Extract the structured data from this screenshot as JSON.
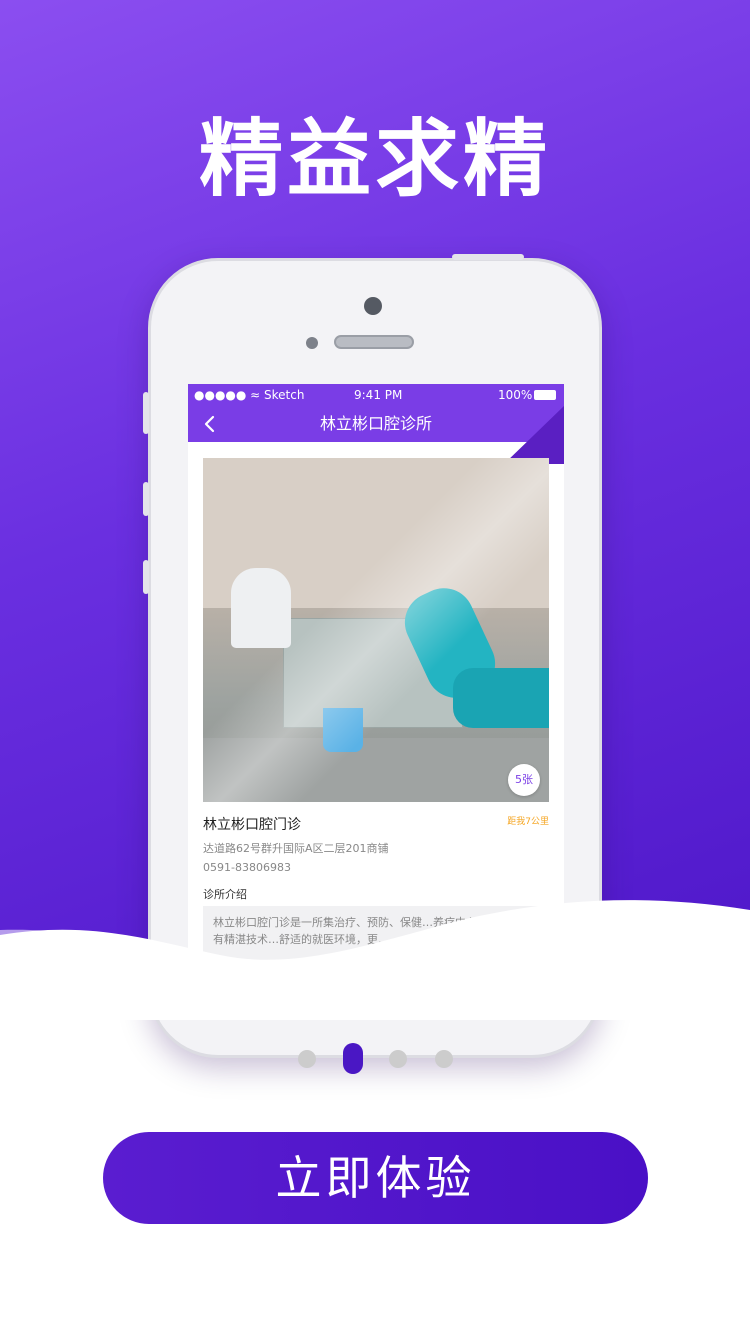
{
  "hero": {
    "title": "精益求精"
  },
  "phone_screen": {
    "status": {
      "carrier": "●●●●● ≈ Sketch",
      "time": "9:41 PM",
      "battery": "100%"
    },
    "navbar": {
      "title": "林立彬口腔诊所",
      "back_icon": "chevron-left-icon"
    },
    "photo": {
      "count_badge": "5张"
    },
    "clinic": {
      "name": "林立彬口腔门诊",
      "distance": "距我7公里",
      "address": "达道路62号群升国际A区二层201商铺",
      "phone": "0591-83806983",
      "intro_title": "诊所介绍",
      "intro_text": "林立彬口腔门诊是一所集治疗、预防、保健…养疗中心。由多名具有精湛技术…舒适的就医环境，更…"
    }
  },
  "pager": {
    "count": 4,
    "active_index": 1
  },
  "cta": {
    "label": "立即体验"
  },
  "colors": {
    "accent": "#6a2fe0",
    "button": "#4a10c6",
    "badge_text": "#7a3de6",
    "distance": "#f5a623"
  }
}
